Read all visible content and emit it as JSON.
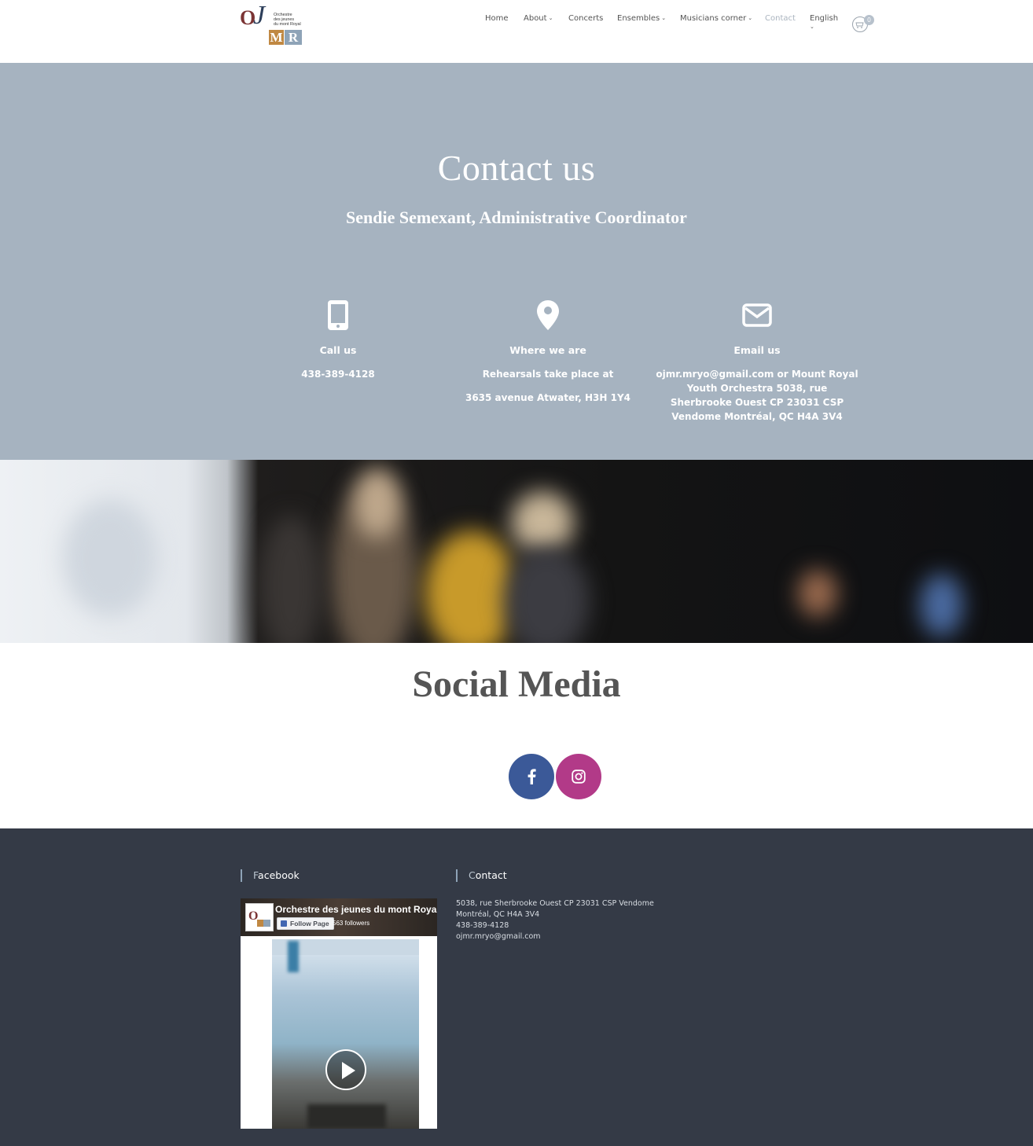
{
  "brand": {
    "logo_letters": {
      "o": "O",
      "j": "J",
      "m": "M",
      "r": "R"
    },
    "logo_tagline": [
      "Orchestre",
      "des jeunes",
      "du mont Royal"
    ]
  },
  "nav": {
    "items": [
      {
        "label": "Home",
        "dropdown": false
      },
      {
        "label": "About",
        "dropdown": true
      },
      {
        "label": "Concerts",
        "dropdown": false
      },
      {
        "label": "Ensembles",
        "dropdown": true
      },
      {
        "label": "Musicians corner",
        "dropdown": true
      },
      {
        "label": "Contact",
        "dropdown": false,
        "active": true
      }
    ],
    "language": "English",
    "cart_count": "0"
  },
  "hero": {
    "title": "Contact us",
    "subtitle": "Sendie Semexant, Administrative Coordinator",
    "columns": [
      {
        "icon": "mobile-phone-icon",
        "title": "Call us",
        "lines": [
          "438-389-4128"
        ]
      },
      {
        "icon": "map-marker-icon",
        "title": "Where we are",
        "lines": [
          "Rehearsals take place at",
          "3635 avenue Atwater, H3H 1Y4"
        ]
      },
      {
        "icon": "envelope-icon",
        "title": "Email us",
        "lines": [
          "ojmr.mryo@gmail.com or Mount Royal Youth Orchestra 5038, rue Sherbrooke Ouest CP 23031 CSP Vendome Montréal, QC H4A 3V4"
        ]
      }
    ]
  },
  "social": {
    "title": "Social Media",
    "buttons": [
      {
        "icon": "facebook-icon",
        "color": "#3b5998"
      },
      {
        "icon": "instagram-icon",
        "color": "#b23a88"
      }
    ]
  },
  "footer": {
    "facebook_heading_first": "F",
    "facebook_heading_rest": "acebook",
    "contact_heading_first": "C",
    "contact_heading_rest": "ontact",
    "fb_widget": {
      "page_name": "Orchestre des jeunes du mont Royal",
      "follow_label": "Follow Page",
      "followers": "563 followers"
    },
    "contact_lines": [
      "5038, rue Sherbrooke Ouest CP 23031 CSP Vendome",
      "Montréal, QC H4A 3V4",
      "438-389-4128",
      "ojmr.mryo@gmail.com"
    ]
  },
  "colors": {
    "hero_bg": "#a6b3c0",
    "footer_bg": "#343a46",
    "accent": "#8ea3b7"
  }
}
